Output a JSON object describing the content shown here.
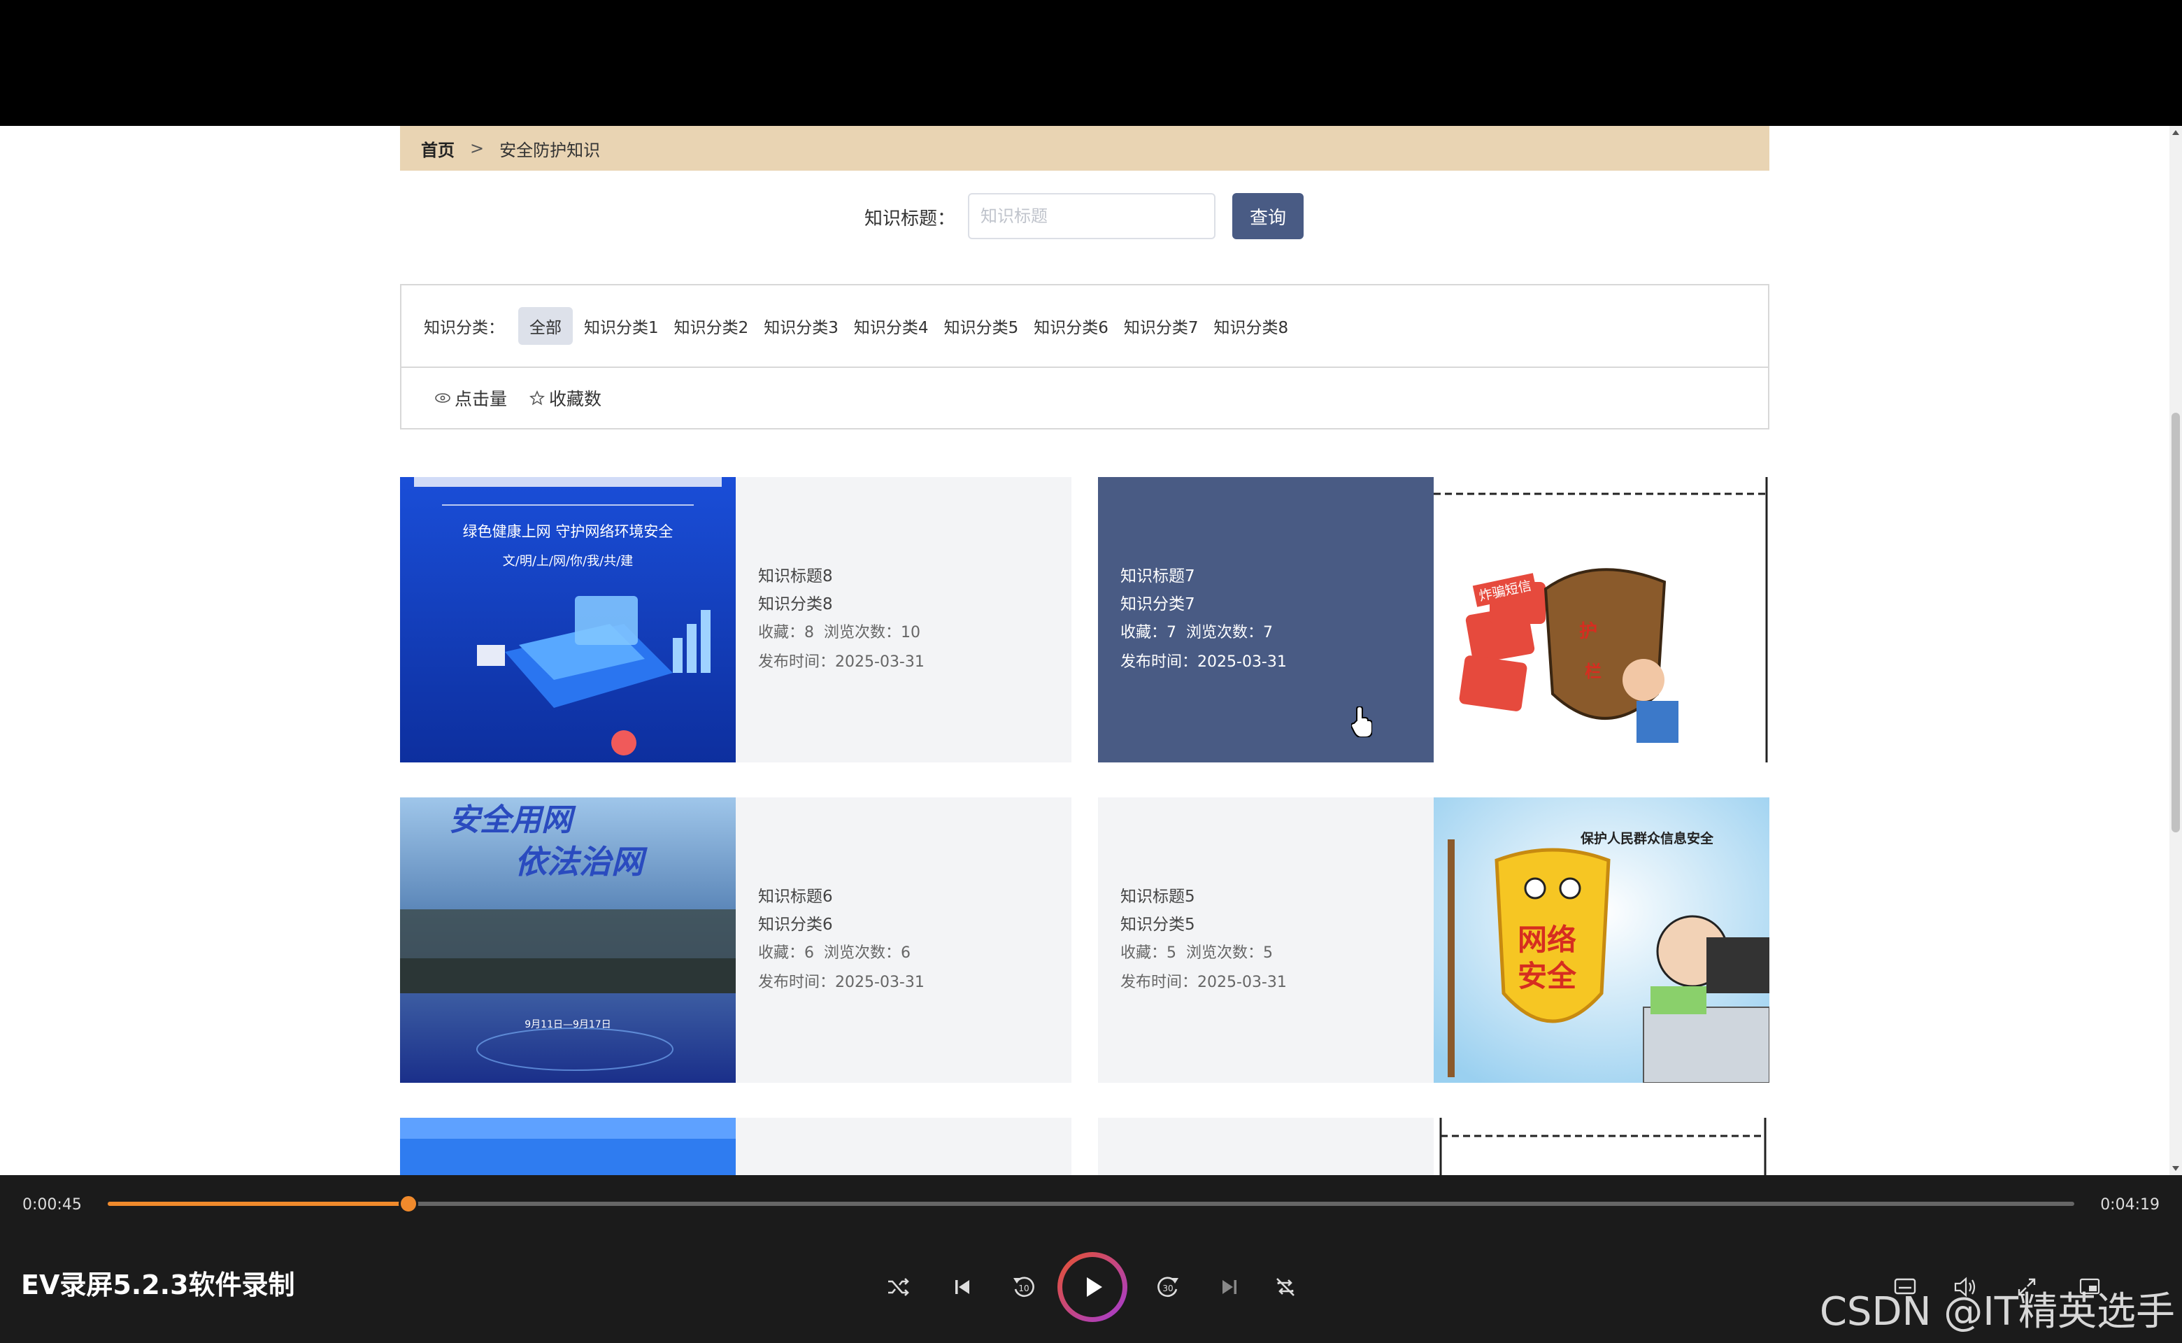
{
  "breadcrumb": {
    "home": "首页",
    "separator": ">",
    "current": "安全防护知识"
  },
  "search": {
    "label": "知识标题：",
    "placeholder": "知识标题",
    "button": "查询"
  },
  "filter": {
    "label": "知识分类：",
    "categories": [
      "全部",
      "知识分类1",
      "知识分类2",
      "知识分类3",
      "知识分类4",
      "知识分类5",
      "知识分类6",
      "知识分类7",
      "知识分类8"
    ],
    "active": "全部"
  },
  "sort": {
    "clicks": "点击量",
    "favorites": "收藏数"
  },
  "cards": [
    {
      "title": "知识标题8",
      "category": "知识分类8",
      "favorites_label": "收藏：",
      "favorites": "8",
      "views_label": "浏览次数：",
      "views": "10",
      "date_label": "发布时间：",
      "date": "2025-03-31",
      "image_text": [
        "绿色健康上网 守护网络环境安全",
        "文/明/上/网/你/我/共/建"
      ]
    },
    {
      "title": "知识标题7",
      "category": "知识分类7",
      "favorites_label": "收藏：",
      "favorites": "7",
      "views_label": "浏览次数：",
      "views": "7",
      "date_label": "发布时间：",
      "date": "2025-03-31",
      "image_text": [
        "炸骗短信",
        "护",
        "栏"
      ]
    },
    {
      "title": "知识标题6",
      "category": "知识分类6",
      "favorites_label": "收藏：",
      "favorites": "6",
      "views_label": "浏览次数：",
      "views": "6",
      "date_label": "发布时间：",
      "date": "2025-03-31",
      "image_text": [
        "安全用网",
        "依法治网",
        "9月11日—9月17日"
      ]
    },
    {
      "title": "知识标题5",
      "category": "知识分类5",
      "favorites_label": "收藏：",
      "favorites": "5",
      "views_label": "浏览次数：",
      "views": "5",
      "date_label": "发布时间：",
      "date": "2025-03-31",
      "image_text": [
        "保护人民群众信息安全",
        "网络",
        "安全"
      ]
    }
  ],
  "player": {
    "current_time": "0:00:45",
    "total_time": "0:04:19",
    "progress": 0.153,
    "title": "EV录屏5.2.3软件录制",
    "accent": "#f08a2c"
  },
  "watermark": "CSDN @IT精英选手"
}
